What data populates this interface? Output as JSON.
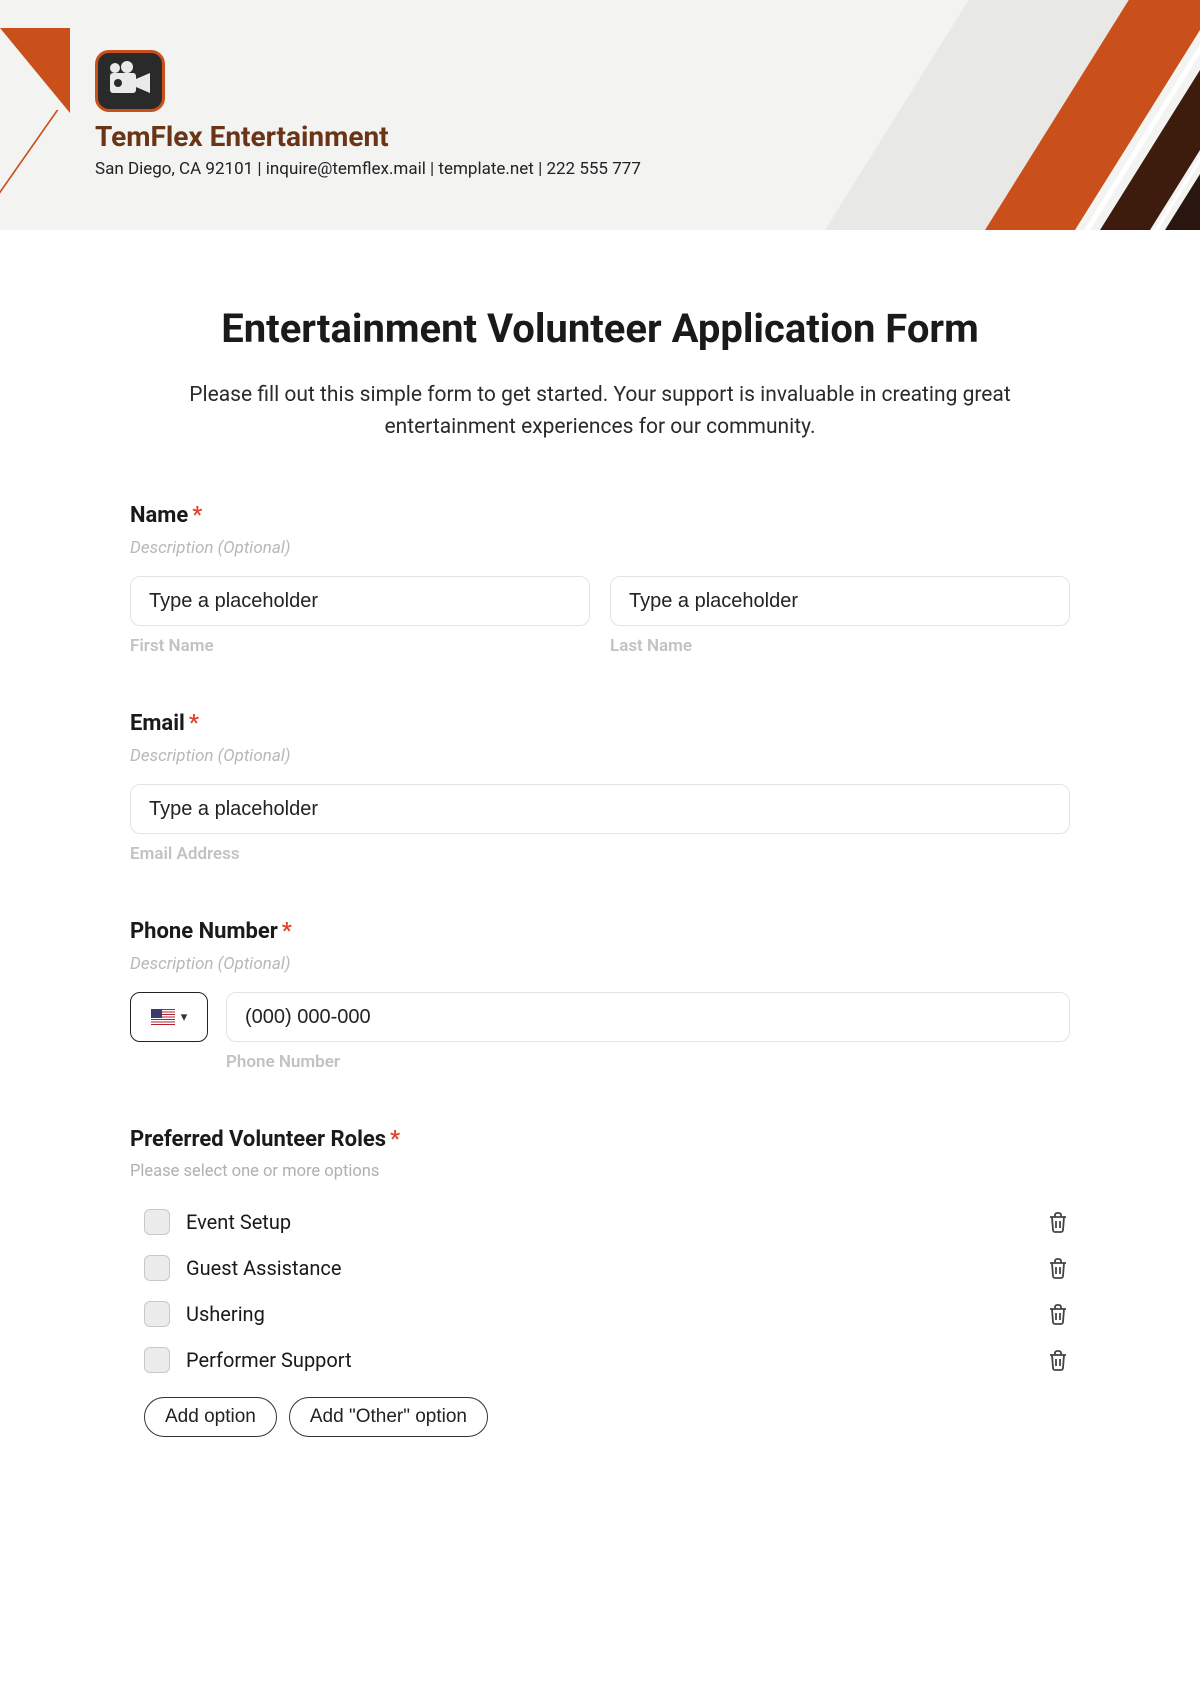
{
  "header": {
    "company_name": "TemFlex Entertainment",
    "contact_line": "San Diego, CA 92101 | inquire@temflex.mail | template.net | 222 555 777"
  },
  "form": {
    "title": "Entertainment Volunteer Application Form",
    "intro": "Please fill out this simple form to get started. Your support is invaluable in creating great entertainment experiences for our community."
  },
  "name_field": {
    "label": "Name",
    "required": "*",
    "desc": "Description (Optional)",
    "first_placeholder": "Type a placeholder",
    "last_placeholder": "Type a placeholder",
    "first_sub": "First Name",
    "last_sub": "Last Name"
  },
  "email_field": {
    "label": "Email",
    "required": "*",
    "desc": "Description (Optional)",
    "placeholder": "Type a placeholder",
    "sub": "Email Address"
  },
  "phone_field": {
    "label": "Phone Number",
    "required": "*",
    "desc": "Description (Optional)",
    "placeholder": "(000) 000-000",
    "sub": "Phone Number"
  },
  "roles_field": {
    "label": "Preferred Volunteer Roles",
    "required": "*",
    "help": "Please select one or more options",
    "options": [
      "Event Setup",
      "Guest Assistance",
      "Ushering",
      "Performer Support"
    ],
    "add_option": "Add option",
    "add_other": "Add \"Other\" option"
  }
}
